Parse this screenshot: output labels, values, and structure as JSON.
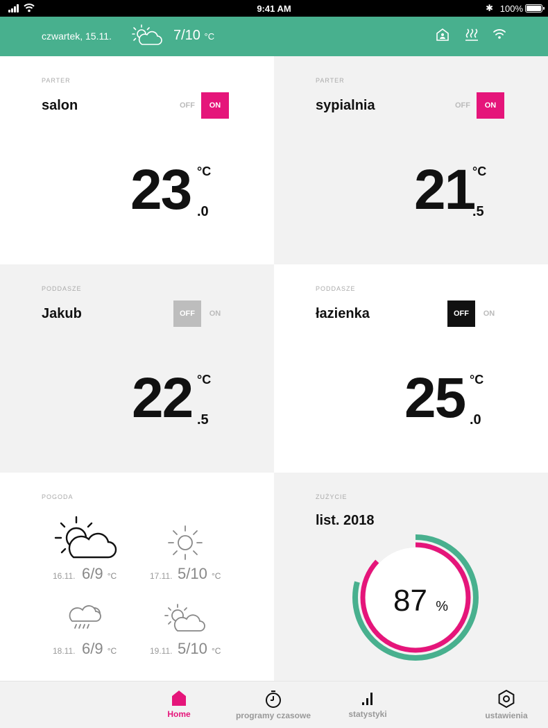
{
  "status": {
    "time": "9:41 AM",
    "battery": "100%"
  },
  "header": {
    "date": "czwartek, 15.11.",
    "temp": "7/10",
    "unit": "°C"
  },
  "rooms": [
    {
      "floor": "PARTER",
      "name": "salon",
      "off": "OFF",
      "on": "ON",
      "state": "on",
      "temp_int": "23",
      "temp_dec": ".0",
      "unit": "°C"
    },
    {
      "floor": "PARTER",
      "name": "sypialnia",
      "off": "OFF",
      "on": "ON",
      "state": "on",
      "temp_int": "21",
      "temp_dec": ".5",
      "unit": "°C"
    },
    {
      "floor": "PODDASZE",
      "name": "Jakub",
      "off": "OFF",
      "on": "ON",
      "state": "off",
      "temp_int": "22",
      "temp_dec": ".5",
      "unit": "°C"
    },
    {
      "floor": "PODDASZE",
      "name": "łazienka",
      "off": "OFF",
      "on": "ON",
      "state": "off",
      "temp_int": "25",
      "temp_dec": ".0",
      "unit": "°C"
    }
  ],
  "weather": {
    "label": "POGODA",
    "days": [
      {
        "date": "16.11.",
        "temp": "6/9",
        "unit": "°C",
        "icon": "partly-cloudy-icon"
      },
      {
        "date": "17.11.",
        "temp": "5/10",
        "unit": "°C",
        "icon": "sun-icon"
      },
      {
        "date": "18.11.",
        "temp": "6/9",
        "unit": "°C",
        "icon": "rain-cloud-icon"
      },
      {
        "date": "19.11.",
        "temp": "5/10",
        "unit": "°C",
        "icon": "partly-cloudy-icon"
      }
    ]
  },
  "usage": {
    "label": "ZUŻYCIE",
    "period": "list. 2018",
    "value": "87",
    "unit": "%",
    "percent": 87
  },
  "nav": {
    "home": "Home",
    "programs": "programy czasowe",
    "stats": "statystyki",
    "settings": "ustawienia"
  },
  "colors": {
    "accent": "#e5157a",
    "green": "#48b08e",
    "grey_tile": "#f2f2f2"
  }
}
